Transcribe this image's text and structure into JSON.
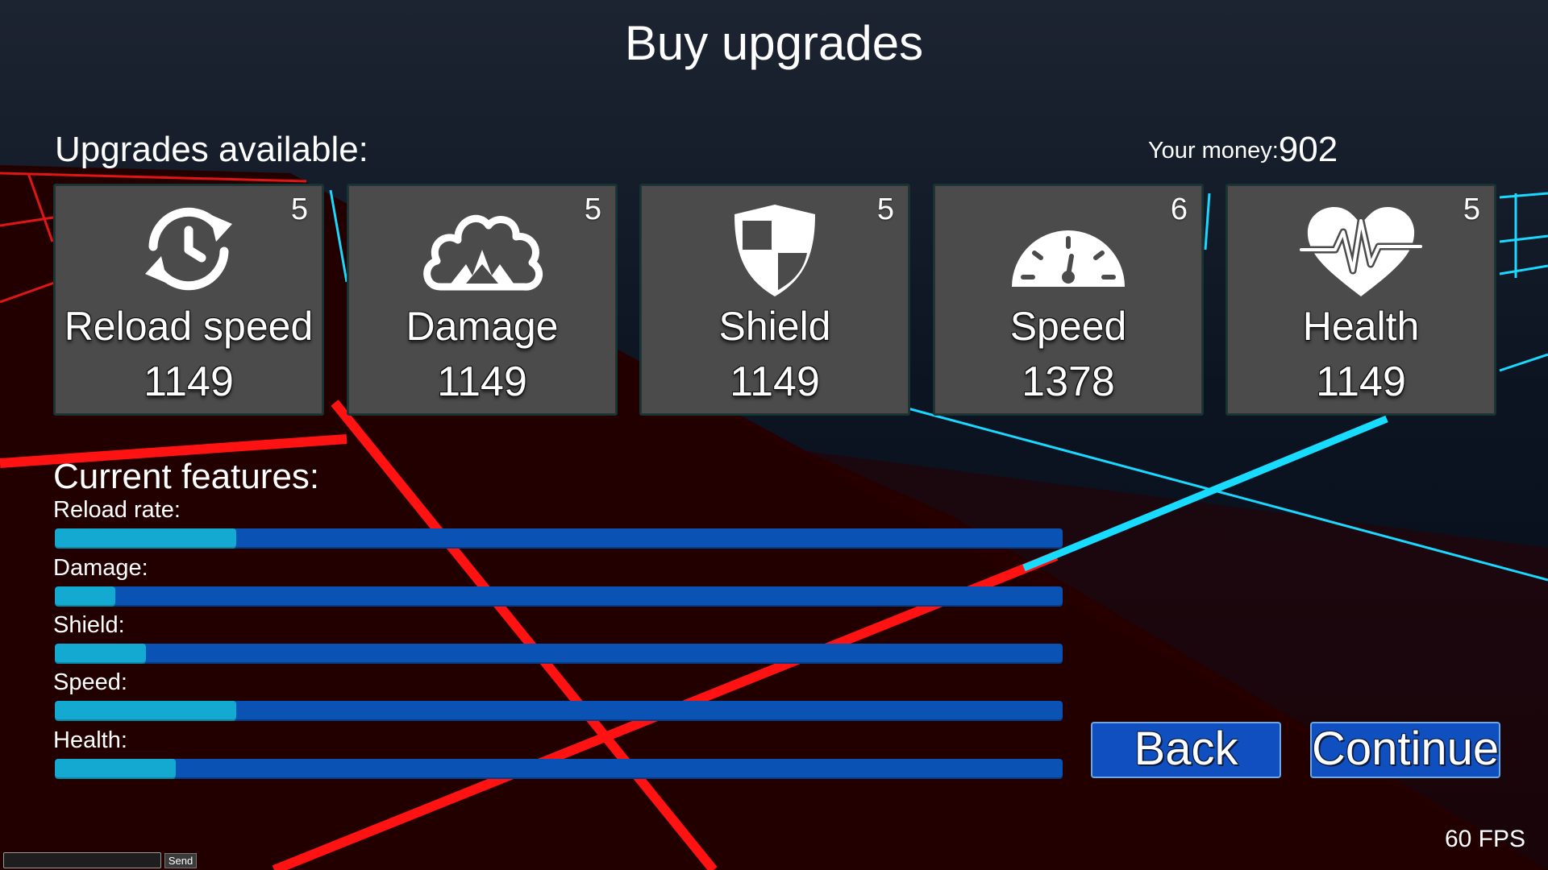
{
  "title": "Buy upgrades",
  "upgrades_label": "Upgrades available:",
  "money": {
    "label": "Your money:",
    "value": "902"
  },
  "upgrades": [
    {
      "name": "Reload speed",
      "price": "1149",
      "level": "5",
      "icon": "reload-clock-icon"
    },
    {
      "name": "Damage",
      "price": "1149",
      "level": "5",
      "icon": "explosion-icon"
    },
    {
      "name": "Shield",
      "price": "1149",
      "level": "5",
      "icon": "shield-icon"
    },
    {
      "name": "Speed",
      "price": "1378",
      "level": "6",
      "icon": "speedometer-icon"
    },
    {
      "name": "Health",
      "price": "1149",
      "level": "5",
      "icon": "heart-pulse-icon"
    }
  ],
  "features_label": "Current features:",
  "features": [
    {
      "label": "Reload rate:",
      "level": 0.18
    },
    {
      "label": "Damage:",
      "level": 0.06
    },
    {
      "label": "Shield:",
      "level": 0.09
    },
    {
      "label": "Speed:",
      "level": 0.18
    },
    {
      "label": "Health:",
      "level": 0.12
    }
  ],
  "buttons": {
    "back": "Back",
    "continue": "Continue"
  },
  "fps": "60 FPS",
  "chat": {
    "send": "Send",
    "input_value": ""
  },
  "colors": {
    "bar_track": "#0a52b4",
    "bar_fill": "#13a9d0",
    "card_bg": "#4b4b4b",
    "floor_red": "#2a0000",
    "grid_red": "#ff1010",
    "grid_cyan": "#18d8ff"
  }
}
